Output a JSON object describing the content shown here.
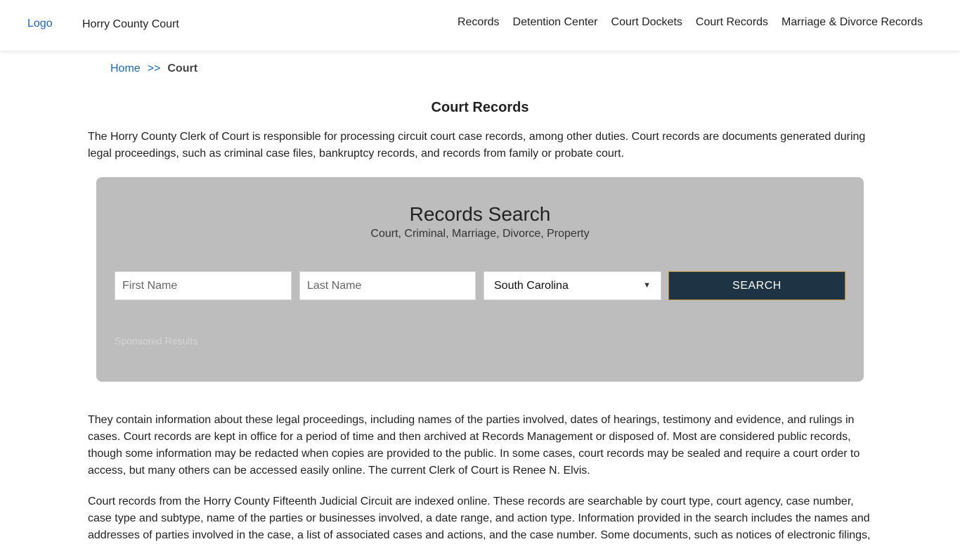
{
  "header": {
    "logo_alt": "Logo",
    "site_name": "Horry County Court",
    "nav": [
      "Records",
      "Detention Center",
      "Court Dockets",
      "Court Records",
      "Marriage & Divorce Records"
    ]
  },
  "breadcrumb": {
    "home": "Home",
    "separator": ">>",
    "current": "Court"
  },
  "page": {
    "title": "Court Records",
    "intro": "The Horry County Clerk of Court is responsible for processing circuit court case records, among other duties. Court records are documents generated during legal proceedings, such as criminal case files, bankruptcy records, and records from family or probate court.",
    "para2": "They contain information about these legal proceedings, including names of the parties involved, dates of hearings, testimony and evidence, and rulings in cases. Court records are kept in office for a period of time and then archived at Records Management or disposed of. Most are considered public records, though some information may be redacted when copies are provided to the public. In some cases, court records may be sealed and require a court order to access, but many others can be accessed easily online. The current Clerk of Court is Renee N. Elvis.",
    "para3": "Court records from the Horry County Fifteenth Judicial Circuit are indexed online. These records are searchable by court type, court agency, case number, case type and subtype, name of the parties or businesses involved, a date range, and action type. Information provided in the search includes the names and addresses of parties involved in the case, a list of associated cases and actions, and the case number. Some documents, such as notices of electronic filings,"
  },
  "search": {
    "title": "Records Search",
    "subtitle": "Court, Criminal, Marriage, Divorce, Property",
    "first_name_placeholder": "First Name",
    "last_name_placeholder": "Last Name",
    "state_selected": "South Carolina",
    "button_label": "SEARCH",
    "sponsored": "Sponsored Results"
  },
  "colors": {
    "link": "#1a66c4",
    "search_panel": "#bdbdbd",
    "search_button": "#1e3444"
  }
}
